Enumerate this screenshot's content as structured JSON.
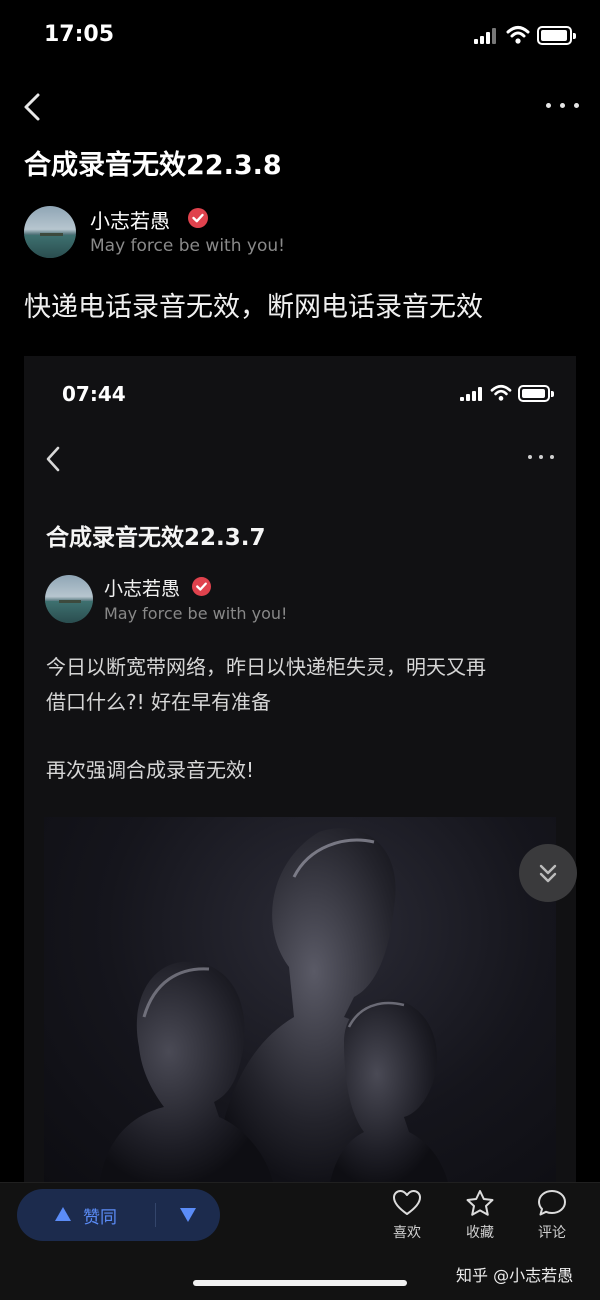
{
  "status_bar": {
    "time": "17:05"
  },
  "nav": {
    "back_icon": "chevron-left-icon",
    "more_icon": "more-dots-icon"
  },
  "article": {
    "title": "合成录音无效22.3.8",
    "author": {
      "name": "小志若愚",
      "bio": "May force be with you!",
      "badge": "verified-badge-icon"
    },
    "body": "快递电话录音无效，断网电话录音无效"
  },
  "embedded_screenshot": {
    "time": "07:44",
    "title": "合成录音无效22.3.7",
    "author": {
      "name": "小志若愚",
      "bio": "May force be with you!"
    },
    "lines": [
      "今日以断宽带网络，昨日以快递柜失灵，明天又再",
      "借口什么?! 好在早有准备",
      "再次强调合成录音无效!"
    ]
  },
  "bottom_bar": {
    "upvote_label": "赞同",
    "actions": [
      {
        "label": "喜欢",
        "icon": "heart-icon"
      },
      {
        "label": "收藏",
        "icon": "star-icon"
      },
      {
        "label": "评论",
        "icon": "comment-icon"
      }
    ]
  },
  "watermark": "知乎 @小志若愚",
  "colors": {
    "accent": "#5b8cf7",
    "vote_bg": "#1c2b4d",
    "verified": "#e0424d",
    "background": "#000000"
  }
}
